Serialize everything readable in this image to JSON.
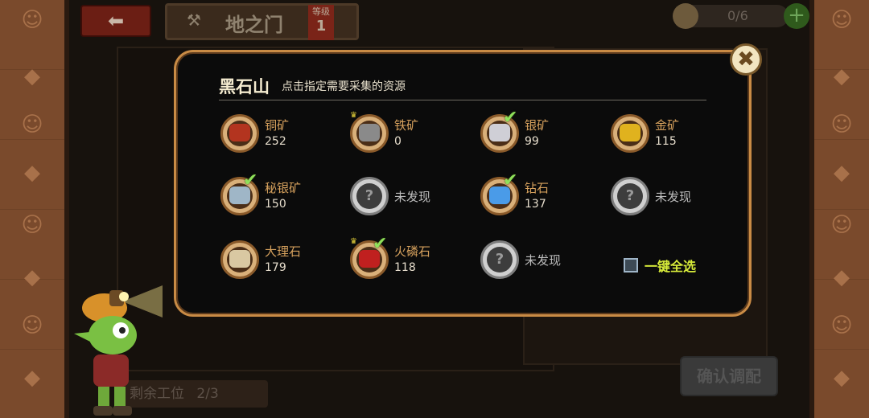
{
  "header": {
    "back_icon": "arrow-left-icon",
    "title": "地之门",
    "level_label": "等级",
    "level_value": "1",
    "workers_count": "0/6",
    "add_icon": "plus-icon"
  },
  "background": {
    "slots_label": "剩余工位",
    "slots_value": "2/3",
    "confirm_label": "确认调配"
  },
  "modal": {
    "title": "黑石山",
    "subtitle": "点击指定需要采集的资源",
    "close_icon": "close-icon",
    "resources": [
      {
        "name": "铜矿",
        "count": "252",
        "color": "#b3341f",
        "checked": false,
        "crown": false
      },
      {
        "name": "铁矿",
        "count": "0",
        "color": "#8a8a8a",
        "checked": false,
        "crown": true
      },
      {
        "name": "银矿",
        "count": "99",
        "color": "#cfcfd6",
        "checked": true,
        "crown": false
      },
      {
        "name": "金矿",
        "count": "115",
        "color": "#e0b21e",
        "checked": false,
        "crown": false
      },
      {
        "name": "秘银矿",
        "count": "150",
        "color": "#9fb6c7",
        "checked": true,
        "crown": false
      },
      {
        "unknown": "未发现"
      },
      {
        "name": "钻石",
        "count": "137",
        "color": "#4a9be8",
        "checked": true,
        "crown": false
      },
      {
        "unknown": "未发现"
      },
      {
        "name": "大理石",
        "count": "179",
        "color": "#d9c8a2",
        "checked": false,
        "crown": false
      },
      {
        "name": "火磷石",
        "count": "118",
        "color": "#c0201f",
        "checked": true,
        "crown": true
      },
      {
        "unknown": "未发现"
      }
    ],
    "select_all_label": "一键全选"
  },
  "colors": {
    "accent_border": "#c98b45",
    "select_all": "#d8ec3a",
    "resource_name": "#d6a15d"
  }
}
